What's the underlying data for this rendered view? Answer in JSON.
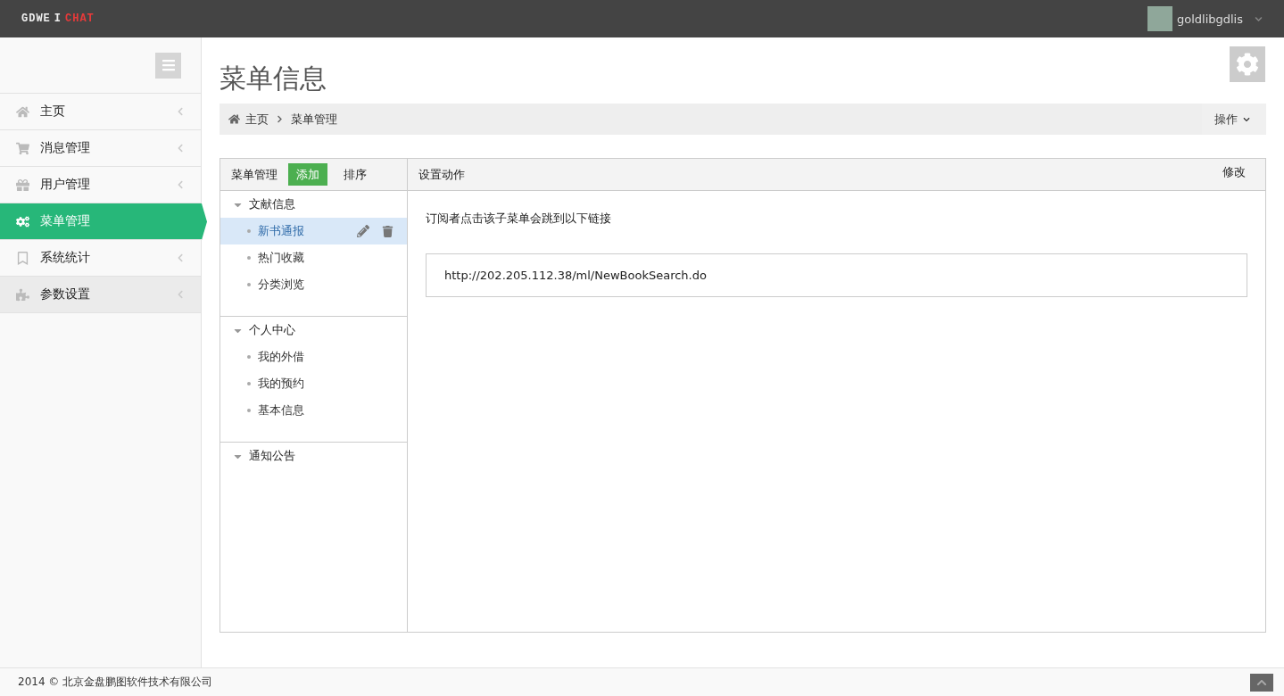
{
  "brand": {
    "part_1": "GDWE",
    "separator": "I",
    "part_2": "CHAT"
  },
  "user": {
    "name": "goldlibgdlis"
  },
  "sidebar": {
    "items": [
      {
        "label": "主页",
        "selected": false,
        "hovered": false
      },
      {
        "label": "消息管理",
        "selected": false,
        "hovered": false
      },
      {
        "label": "用户管理",
        "selected": false,
        "hovered": false
      },
      {
        "label": "菜单管理",
        "selected": true,
        "hovered": false
      },
      {
        "label": "系统统计",
        "selected": false,
        "hovered": false
      },
      {
        "label": "参数设置",
        "selected": false,
        "hovered": true
      }
    ]
  },
  "page_title": "菜单信息",
  "breadcrumb": [
    "主页",
    "菜单管理"
  ],
  "actions_button": "操作",
  "menu_panel": {
    "title": "菜单管理",
    "add_button": "添加",
    "sort_button": "排序",
    "tree": [
      {
        "label": "文献信息",
        "expanded": true,
        "children": [
          {
            "label": "新书通报",
            "selected": true
          },
          {
            "label": "热门收藏",
            "selected": false
          },
          {
            "label": "分类浏览",
            "selected": false
          }
        ]
      },
      {
        "label": "个人中心",
        "expanded": true,
        "children": [
          {
            "label": "我的外借",
            "selected": false
          },
          {
            "label": "我的预约",
            "selected": false
          },
          {
            "label": "基本信息",
            "selected": false
          }
        ]
      },
      {
        "label": "通知公告",
        "expanded": true
      }
    ]
  },
  "action_panel": {
    "title": "设置动作",
    "edit_button": "修改",
    "description": "订阅者点击该子菜单会跳到以下链接",
    "url": "http://202.205.112.38/ml/NewBookSearch.do"
  },
  "footer": "2014 © 北京金盘鹏图软件技术有限公司"
}
